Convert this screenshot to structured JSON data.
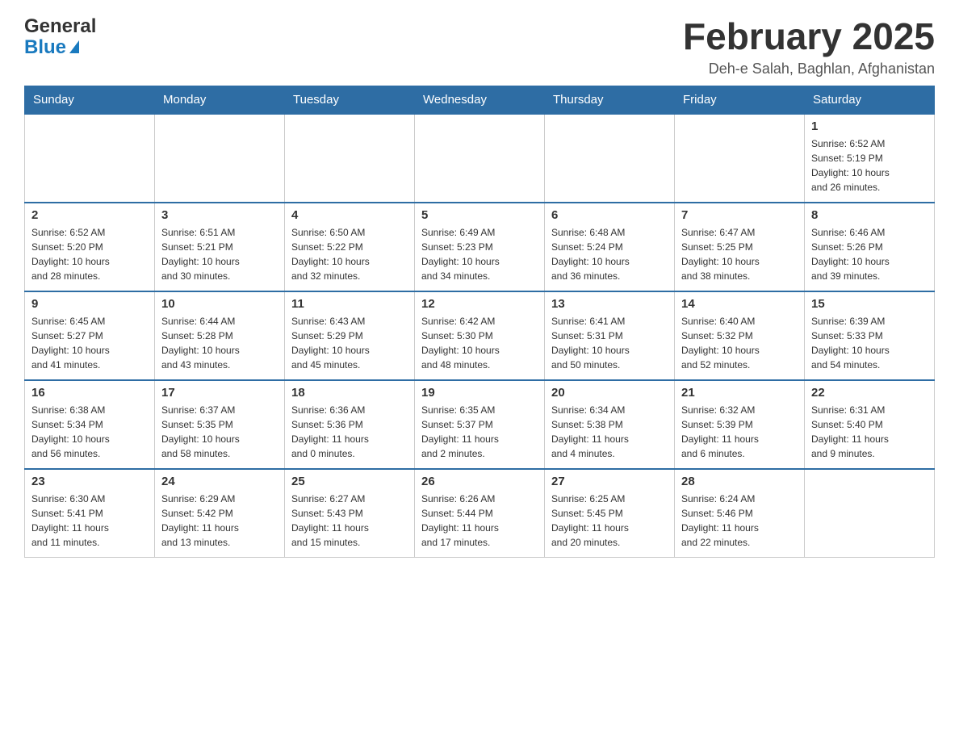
{
  "header": {
    "logo": {
      "general": "General",
      "blue": "Blue"
    },
    "title": "February 2025",
    "subtitle": "Deh-e Salah, Baghlan, Afghanistan"
  },
  "weekdays": [
    "Sunday",
    "Monday",
    "Tuesday",
    "Wednesday",
    "Thursday",
    "Friday",
    "Saturday"
  ],
  "weeks": [
    [
      {
        "day": "",
        "info": ""
      },
      {
        "day": "",
        "info": ""
      },
      {
        "day": "",
        "info": ""
      },
      {
        "day": "",
        "info": ""
      },
      {
        "day": "",
        "info": ""
      },
      {
        "day": "",
        "info": ""
      },
      {
        "day": "1",
        "info": "Sunrise: 6:52 AM\nSunset: 5:19 PM\nDaylight: 10 hours\nand 26 minutes."
      }
    ],
    [
      {
        "day": "2",
        "info": "Sunrise: 6:52 AM\nSunset: 5:20 PM\nDaylight: 10 hours\nand 28 minutes."
      },
      {
        "day": "3",
        "info": "Sunrise: 6:51 AM\nSunset: 5:21 PM\nDaylight: 10 hours\nand 30 minutes."
      },
      {
        "day": "4",
        "info": "Sunrise: 6:50 AM\nSunset: 5:22 PM\nDaylight: 10 hours\nand 32 minutes."
      },
      {
        "day": "5",
        "info": "Sunrise: 6:49 AM\nSunset: 5:23 PM\nDaylight: 10 hours\nand 34 minutes."
      },
      {
        "day": "6",
        "info": "Sunrise: 6:48 AM\nSunset: 5:24 PM\nDaylight: 10 hours\nand 36 minutes."
      },
      {
        "day": "7",
        "info": "Sunrise: 6:47 AM\nSunset: 5:25 PM\nDaylight: 10 hours\nand 38 minutes."
      },
      {
        "day": "8",
        "info": "Sunrise: 6:46 AM\nSunset: 5:26 PM\nDaylight: 10 hours\nand 39 minutes."
      }
    ],
    [
      {
        "day": "9",
        "info": "Sunrise: 6:45 AM\nSunset: 5:27 PM\nDaylight: 10 hours\nand 41 minutes."
      },
      {
        "day": "10",
        "info": "Sunrise: 6:44 AM\nSunset: 5:28 PM\nDaylight: 10 hours\nand 43 minutes."
      },
      {
        "day": "11",
        "info": "Sunrise: 6:43 AM\nSunset: 5:29 PM\nDaylight: 10 hours\nand 45 minutes."
      },
      {
        "day": "12",
        "info": "Sunrise: 6:42 AM\nSunset: 5:30 PM\nDaylight: 10 hours\nand 48 minutes."
      },
      {
        "day": "13",
        "info": "Sunrise: 6:41 AM\nSunset: 5:31 PM\nDaylight: 10 hours\nand 50 minutes."
      },
      {
        "day": "14",
        "info": "Sunrise: 6:40 AM\nSunset: 5:32 PM\nDaylight: 10 hours\nand 52 minutes."
      },
      {
        "day": "15",
        "info": "Sunrise: 6:39 AM\nSunset: 5:33 PM\nDaylight: 10 hours\nand 54 minutes."
      }
    ],
    [
      {
        "day": "16",
        "info": "Sunrise: 6:38 AM\nSunset: 5:34 PM\nDaylight: 10 hours\nand 56 minutes."
      },
      {
        "day": "17",
        "info": "Sunrise: 6:37 AM\nSunset: 5:35 PM\nDaylight: 10 hours\nand 58 minutes."
      },
      {
        "day": "18",
        "info": "Sunrise: 6:36 AM\nSunset: 5:36 PM\nDaylight: 11 hours\nand 0 minutes."
      },
      {
        "day": "19",
        "info": "Sunrise: 6:35 AM\nSunset: 5:37 PM\nDaylight: 11 hours\nand 2 minutes."
      },
      {
        "day": "20",
        "info": "Sunrise: 6:34 AM\nSunset: 5:38 PM\nDaylight: 11 hours\nand 4 minutes."
      },
      {
        "day": "21",
        "info": "Sunrise: 6:32 AM\nSunset: 5:39 PM\nDaylight: 11 hours\nand 6 minutes."
      },
      {
        "day": "22",
        "info": "Sunrise: 6:31 AM\nSunset: 5:40 PM\nDaylight: 11 hours\nand 9 minutes."
      }
    ],
    [
      {
        "day": "23",
        "info": "Sunrise: 6:30 AM\nSunset: 5:41 PM\nDaylight: 11 hours\nand 11 minutes."
      },
      {
        "day": "24",
        "info": "Sunrise: 6:29 AM\nSunset: 5:42 PM\nDaylight: 11 hours\nand 13 minutes."
      },
      {
        "day": "25",
        "info": "Sunrise: 6:27 AM\nSunset: 5:43 PM\nDaylight: 11 hours\nand 15 minutes."
      },
      {
        "day": "26",
        "info": "Sunrise: 6:26 AM\nSunset: 5:44 PM\nDaylight: 11 hours\nand 17 minutes."
      },
      {
        "day": "27",
        "info": "Sunrise: 6:25 AM\nSunset: 5:45 PM\nDaylight: 11 hours\nand 20 minutes."
      },
      {
        "day": "28",
        "info": "Sunrise: 6:24 AM\nSunset: 5:46 PM\nDaylight: 11 hours\nand 22 minutes."
      },
      {
        "day": "",
        "info": ""
      }
    ]
  ]
}
